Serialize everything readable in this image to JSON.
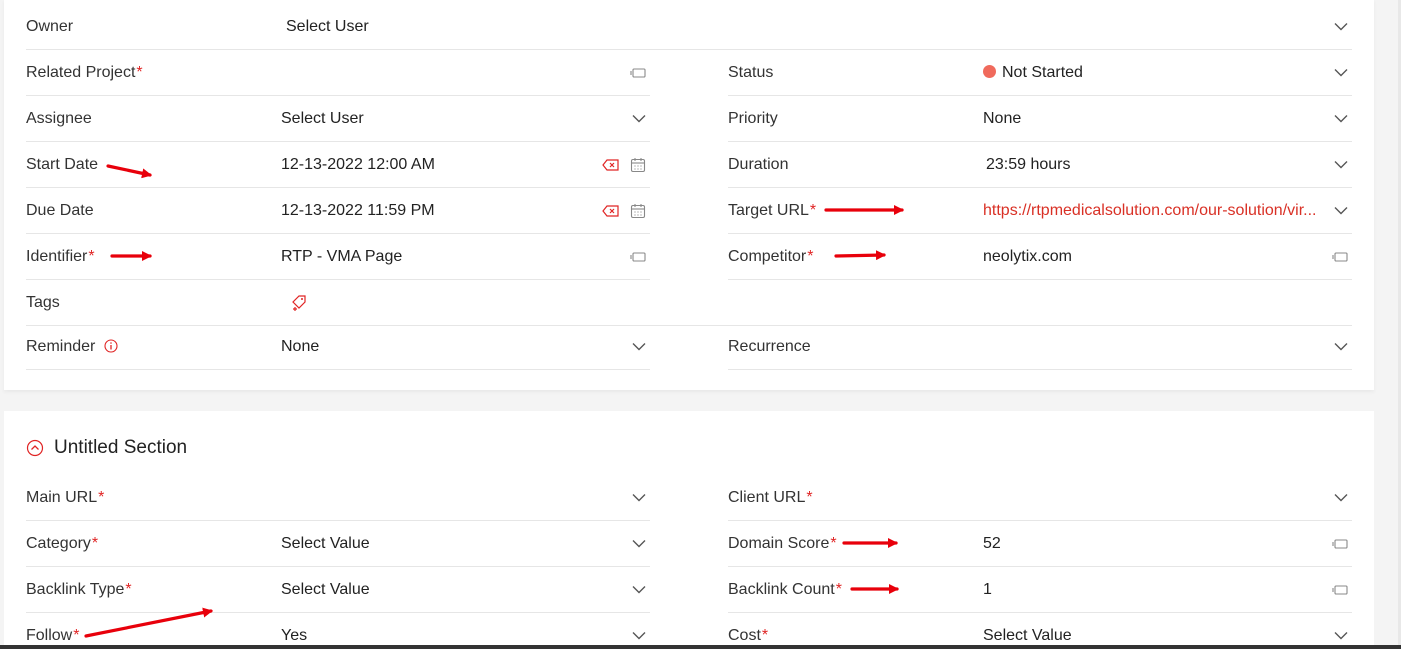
{
  "task_details": {
    "owner": {
      "label": "Owner",
      "value": "Select User"
    },
    "related_project": {
      "label": "Related Project",
      "value": ""
    },
    "status": {
      "label": "Status",
      "value": "Not Started",
      "dot_color": "#f06a5c"
    },
    "assignee": {
      "label": "Assignee",
      "value": "Select User"
    },
    "priority": {
      "label": "Priority",
      "value": "None"
    },
    "start_date": {
      "label": "Start Date",
      "value": "12-13-2022 12:00 AM"
    },
    "duration": {
      "label": "Duration",
      "value": "23:59 hours"
    },
    "due_date": {
      "label": "Due Date",
      "value": "12-13-2022 11:59 PM"
    },
    "target_url": {
      "label": "Target URL",
      "value": "https://rtpmedicalsolution.com/our-solution/vir..."
    },
    "identifier": {
      "label": "Identifier",
      "value": "RTP - VMA Page"
    },
    "competitor": {
      "label": "Competitor",
      "value": "neolytix.com"
    },
    "tags": {
      "label": "Tags"
    },
    "reminder": {
      "label": "Reminder",
      "value": "None"
    },
    "recurrence": {
      "label": "Recurrence",
      "value": ""
    }
  },
  "untitled_section": {
    "title": "Untitled Section",
    "main_url": {
      "label": "Main URL",
      "value": ""
    },
    "client_url": {
      "label": "Client URL",
      "value": ""
    },
    "category": {
      "label": "Category",
      "value": "Select Value"
    },
    "domain_score": {
      "label": "Domain Score",
      "value": "52"
    },
    "backlink_type": {
      "label": "Backlink Type",
      "value": "Select Value"
    },
    "backlink_count": {
      "label": "Backlink Count",
      "value": "1"
    },
    "follow": {
      "label": "Follow",
      "value": "Yes"
    },
    "cost": {
      "label": "Cost",
      "value": "Select Value"
    }
  },
  "required_marker": "*",
  "colors": {
    "accent": "#e02424",
    "link": "#d93025",
    "annotation_arrow": "#e8000b"
  }
}
